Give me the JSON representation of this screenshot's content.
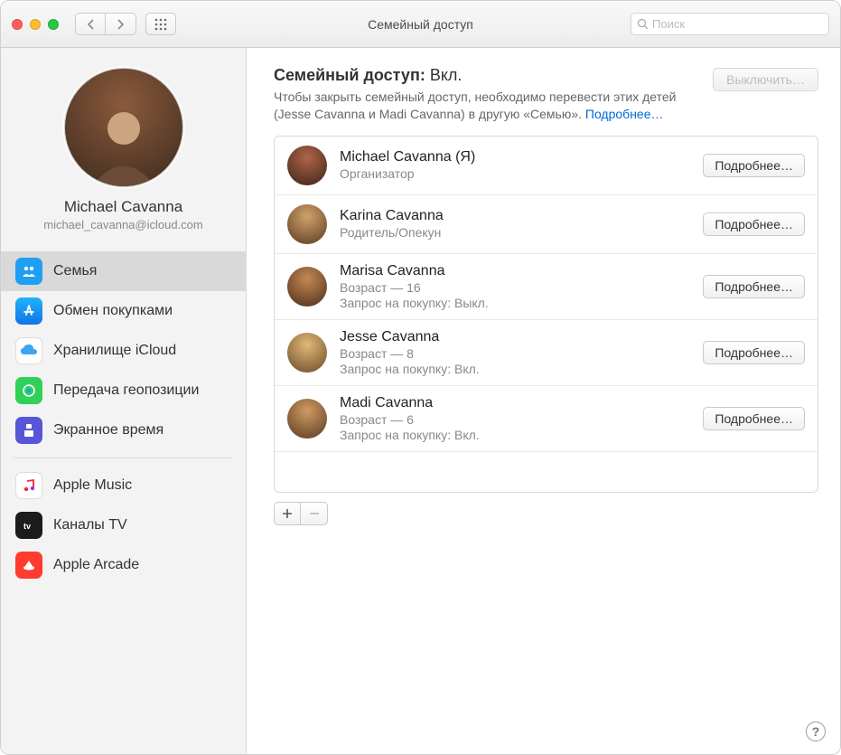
{
  "window": {
    "title": "Семейный доступ",
    "search_placeholder": "Поиск"
  },
  "profile": {
    "name": "Michael Cavanna",
    "email": "michael_cavanna@icloud.com"
  },
  "sidebar": {
    "group1": [
      {
        "label": "Семья",
        "icon": "family",
        "color": "#1e9ff2",
        "selected": true
      },
      {
        "label": "Обмен покупками",
        "icon": "appstore",
        "color": "#1a8ff0",
        "selected": false
      },
      {
        "label": "Хранилище iCloud",
        "icon": "icloud",
        "color": "#ffffff",
        "selected": false
      },
      {
        "label": "Передача геопозиции",
        "icon": "location",
        "color": "#30d158",
        "selected": false
      },
      {
        "label": "Экранное время",
        "icon": "screen",
        "color": "#5856d6",
        "selected": false
      }
    ],
    "group2": [
      {
        "label": "Apple Music",
        "icon": "music",
        "color": "#ffffff",
        "selected": false
      },
      {
        "label": "Каналы TV",
        "icon": "tv",
        "color": "#1c1c1e",
        "selected": false
      },
      {
        "label": "Apple Arcade",
        "icon": "arcade",
        "color": "#ff3b30",
        "selected": false
      }
    ]
  },
  "content": {
    "heading_prefix": "Семейный доступ:",
    "heading_status": "Вкл.",
    "turn_off_label": "Выключить…",
    "description_part1": "Чтобы закрыть семейный доступ, необходимо перевести этих детей (Jesse Cavanna и Madi Cavanna) в другую «Семью». ",
    "learn_more": "Подробнее…",
    "more_label": "Подробнее…",
    "members": [
      {
        "name": "Michael Cavanna (Я)",
        "role": "Организатор",
        "line2": "",
        "hue": "12"
      },
      {
        "name": "Karina Cavanna",
        "role": "Родитель/Опекун",
        "line2": "",
        "hue": "40"
      },
      {
        "name": "Marisa Cavanna",
        "role": "Возраст — 16",
        "line2": "Запрос на покупку: Выкл.",
        "hue": "25"
      },
      {
        "name": "Jesse Cavanna",
        "role": "Возраст — 8",
        "line2": "Запрос на покупку: Вкл.",
        "hue": "50"
      },
      {
        "name": "Madi Cavanna",
        "role": "Возраст — 6",
        "line2": "Запрос на покупку: Вкл.",
        "hue": "30"
      }
    ]
  }
}
